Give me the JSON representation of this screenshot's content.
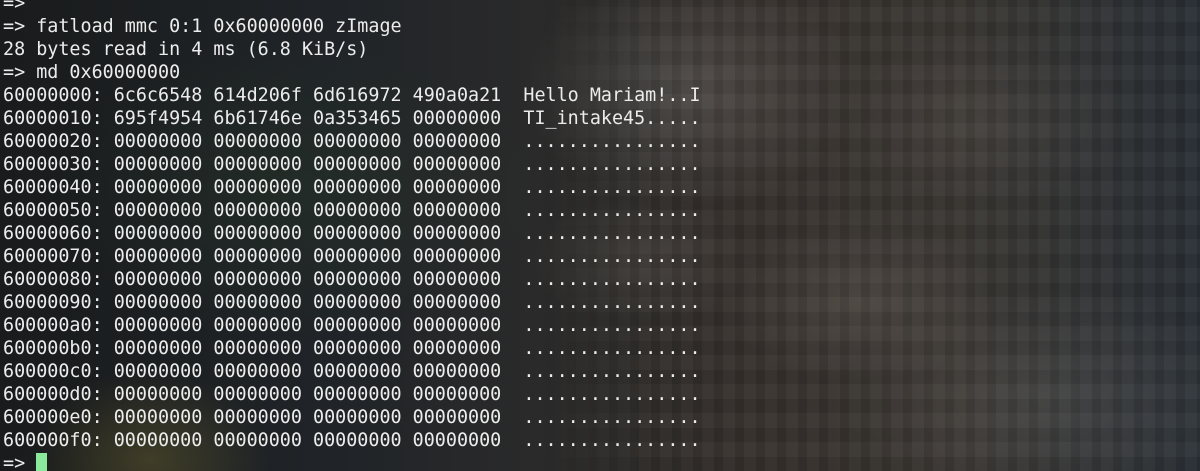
{
  "terminal": {
    "lines": [
      "=>",
      "=> fatload mmc 0:1 0x60000000 zImage",
      "28 bytes read in 4 ms (6.8 KiB/s)",
      "=> md 0x60000000",
      "60000000: 6c6c6548 614d206f 6d616972 490a0a21  Hello Mariam!..I",
      "60000010: 695f4954 6b61746e 0a353465 00000000  TI_intake45.....",
      "60000020: 00000000 00000000 00000000 00000000  ................",
      "60000030: 00000000 00000000 00000000 00000000  ................",
      "60000040: 00000000 00000000 00000000 00000000  ................",
      "60000050: 00000000 00000000 00000000 00000000  ................",
      "60000060: 00000000 00000000 00000000 00000000  ................",
      "60000070: 00000000 00000000 00000000 00000000  ................",
      "60000080: 00000000 00000000 00000000 00000000  ................",
      "60000090: 00000000 00000000 00000000 00000000  ................",
      "600000a0: 00000000 00000000 00000000 00000000  ................",
      "600000b0: 00000000 00000000 00000000 00000000  ................",
      "600000c0: 00000000 00000000 00000000 00000000  ................",
      "600000d0: 00000000 00000000 00000000 00000000  ................",
      "600000e0: 00000000 00000000 00000000 00000000  ................",
      "600000f0: 00000000 00000000 00000000 00000000  ................"
    ],
    "prompt": "=> ",
    "colors": {
      "text": "#ececec",
      "cursor": "#8ae99b"
    }
  }
}
